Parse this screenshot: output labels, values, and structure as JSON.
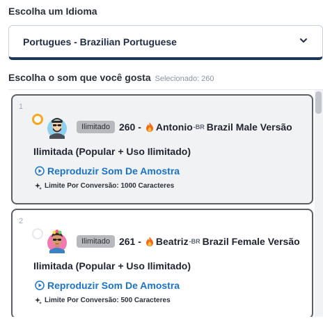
{
  "language": {
    "label": "Escolha um Idioma",
    "selected": "Portugues - Brazilian Portuguese"
  },
  "sounds": {
    "heading": "Escolha o som que você gosta",
    "selected_text": "Selecionado: 260",
    "items": [
      {
        "index": "1",
        "selected": true,
        "badge": "Ilimitado",
        "title_prefix": "260 -",
        "name": "Antonio",
        "locale": "-BR",
        "title_suffix": "Brazil Male Versão",
        "title_line2": "Ilimitada (Popular + Uso Ilimitado)",
        "play_label": "Reproduzir Som De Amostra",
        "limit_text": "Limite Por Conversão: 1000 Caracteres"
      },
      {
        "index": "2",
        "selected": false,
        "badge": "Ilimitado",
        "title_prefix": "261 -",
        "name": "Beatriz",
        "locale": "-BR",
        "title_suffix": "Brazil Female Versão",
        "title_line2": "Ilimitada (Popular + Uso Ilimitado)",
        "play_label": "Reproduzir Som De Amostra",
        "limit_text": "Limite Por Conversão: 500 Caracteres"
      }
    ]
  },
  "colors": {
    "accent_link": "#1a73c8",
    "radio_selected": "#f5a623",
    "select_underline": "#1d3557"
  }
}
